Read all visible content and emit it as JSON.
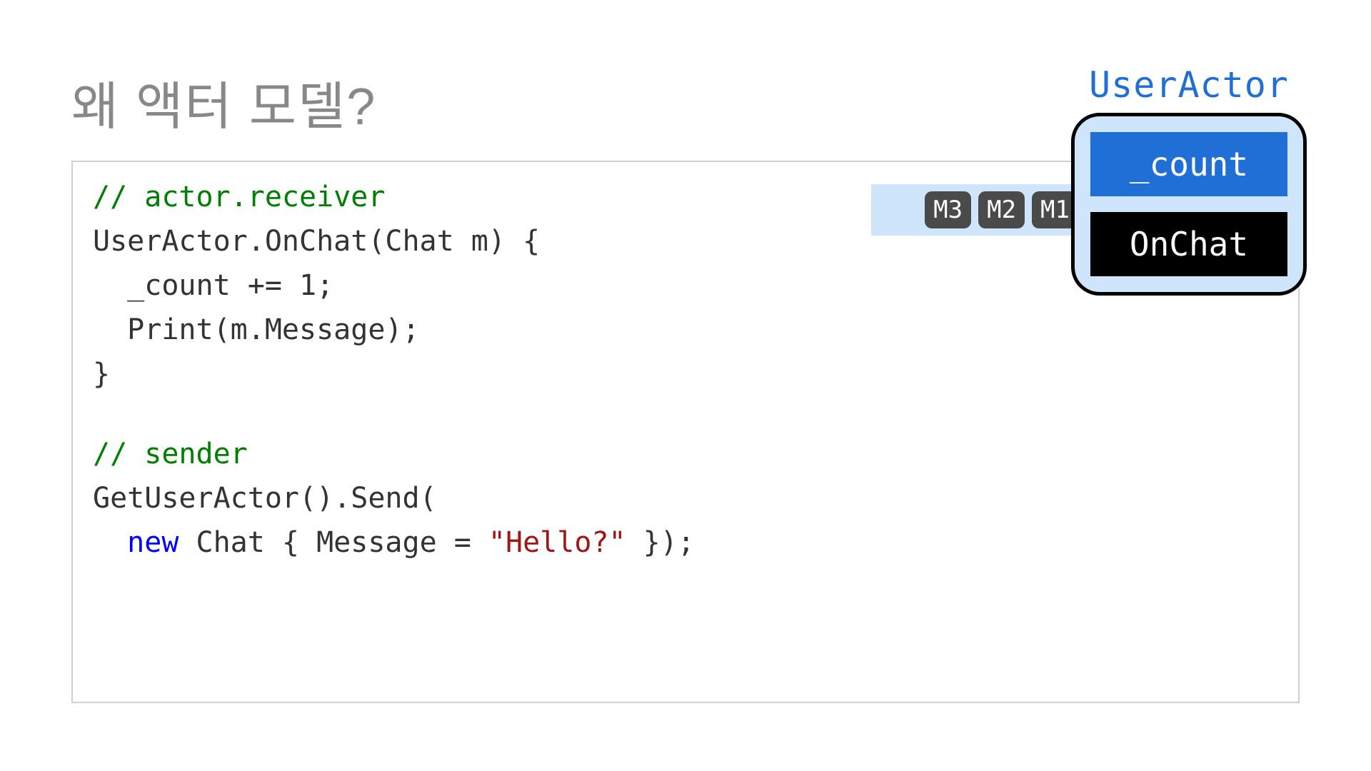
{
  "title": "왜 액터 모델?",
  "code": {
    "comment1": "// actor.receiver",
    "line1": "UserActor.OnChat(Chat m) {",
    "line2": "  _count += 1;",
    "line3": "  Print(m.Message);",
    "line4": "}",
    "comment2": "// sender",
    "line5": "GetUserActor().Send(",
    "line6a": "  ",
    "line6_new": "new",
    "line6b": " Chat { Message = ",
    "line6_str": "\"Hello?\"",
    "line6c": " });"
  },
  "diagram": {
    "actor_label": "UserActor",
    "messages": [
      "M3",
      "M2",
      "M1"
    ],
    "state": "_count",
    "method": "OnChat"
  }
}
